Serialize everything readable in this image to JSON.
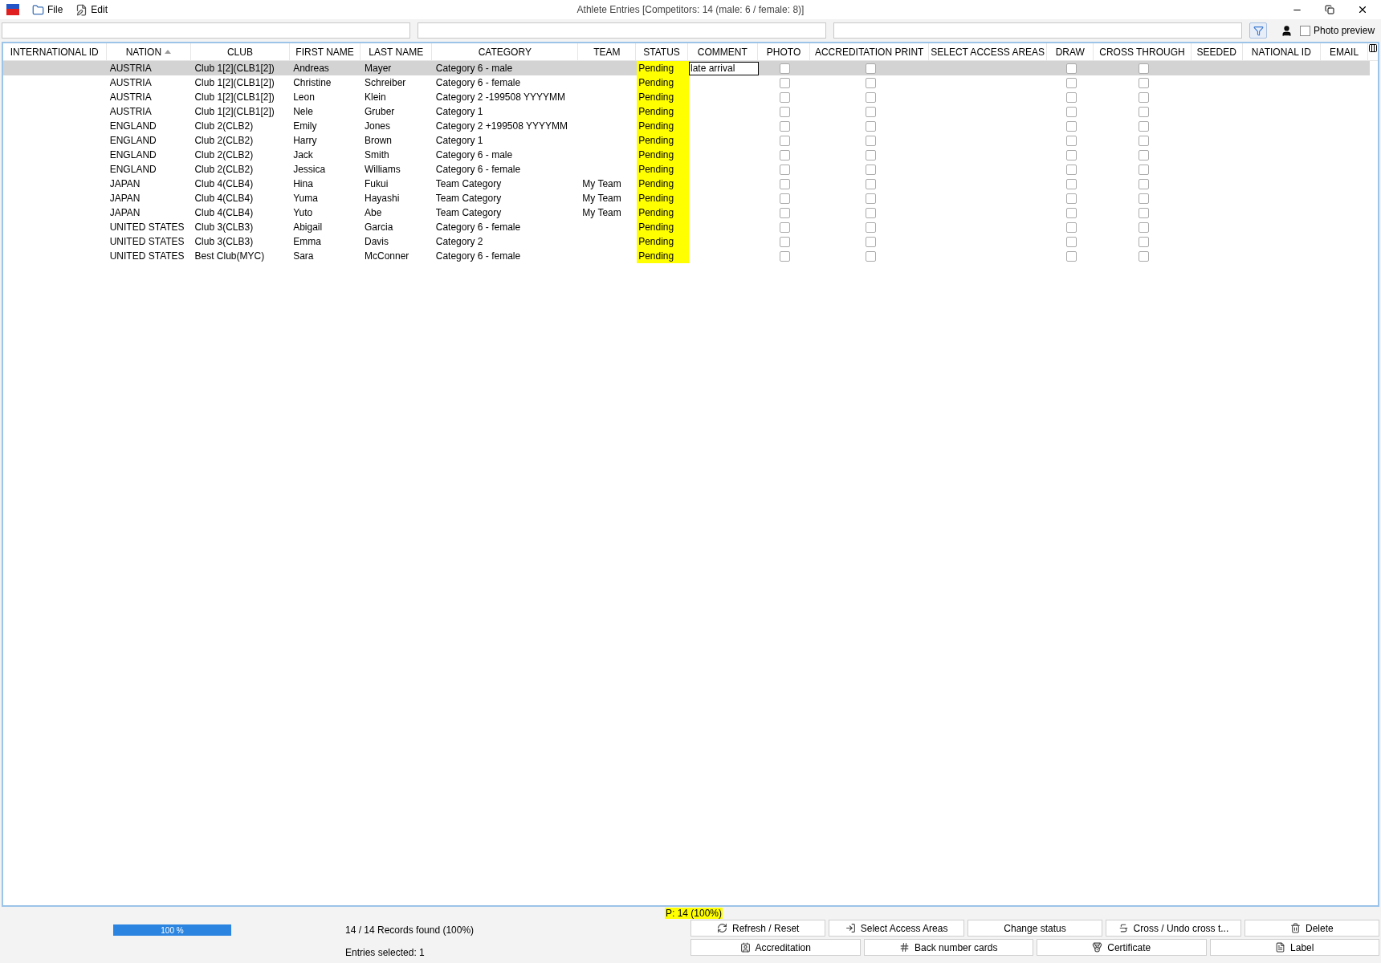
{
  "window": {
    "title": "Athlete Entries [Competitors: 14 (male: 6 / female: 8)]"
  },
  "menu": [
    "File",
    "Edit"
  ],
  "photo_preview": {
    "label": "Photo preview",
    "checked": false
  },
  "table": {
    "columns": [
      {
        "label": "INTERNATIONAL ID",
        "sorted": false
      },
      {
        "label": "NATION",
        "sorted": true
      },
      {
        "label": "CLUB",
        "sorted": false
      },
      {
        "label": "FIRST NAME",
        "sorted": false
      },
      {
        "label": "LAST NAME",
        "sorted": false
      },
      {
        "label": "CATEGORY",
        "sorted": false
      },
      {
        "label": "TEAM",
        "sorted": false
      },
      {
        "label": "STATUS",
        "sorted": false,
        "kind": "status"
      },
      {
        "label": "COMMENT",
        "sorted": false,
        "kind": "comment"
      },
      {
        "label": "PHOTO",
        "sorted": false,
        "kind": "checkbox"
      },
      {
        "label": "ACCREDITATION PRINT",
        "sorted": false,
        "kind": "checkbox"
      },
      {
        "label": "SELECT ACCESS AREAS",
        "sorted": false
      },
      {
        "label": "DRAW",
        "sorted": false,
        "kind": "checkbox"
      },
      {
        "label": "CROSS THROUGH",
        "sorted": false,
        "kind": "checkbox"
      },
      {
        "label": "SEEDED",
        "sorted": false
      },
      {
        "label": "NATIONAL ID",
        "sorted": false
      },
      {
        "label": "EMAIL",
        "sorted": false
      }
    ],
    "rows": [
      {
        "selected": true,
        "nation": "AUSTRIA",
        "club": "Club 1[2](CLB1[2])",
        "first_name": "Andreas",
        "last_name": "Mayer",
        "category": "Category 6 - male",
        "status": "Pending",
        "comment": "late arrival",
        "photo": false,
        "accreditation_print": false,
        "draw": false,
        "cross_through": false
      },
      {
        "selected": false,
        "nation": "AUSTRIA",
        "club": "Club 1[2](CLB1[2])",
        "first_name": "Christine",
        "last_name": "Schreiber",
        "category": "Category 6 - female",
        "status": "Pending",
        "photo": false,
        "accreditation_print": false,
        "draw": false,
        "cross_through": false
      },
      {
        "selected": false,
        "nation": "AUSTRIA",
        "club": "Club 1[2](CLB1[2])",
        "first_name": "Leon",
        "last_name": "Klein",
        "category": "Category 2 -199508 YYYYMM",
        "status": "Pending",
        "photo": false,
        "accreditation_print": false,
        "draw": false,
        "cross_through": false
      },
      {
        "selected": false,
        "nation": "AUSTRIA",
        "club": "Club 1[2](CLB1[2])",
        "first_name": "Nele",
        "last_name": "Gruber",
        "category": "Category 1",
        "status": "Pending",
        "photo": false,
        "accreditation_print": false,
        "draw": false,
        "cross_through": false
      },
      {
        "selected": false,
        "nation": "ENGLAND",
        "club": "Club 2(CLB2)",
        "first_name": "Emily",
        "last_name": "Jones",
        "category": "Category 2 +199508 YYYYMM",
        "status": "Pending",
        "photo": false,
        "accreditation_print": false,
        "draw": false,
        "cross_through": false
      },
      {
        "selected": false,
        "nation": "ENGLAND",
        "club": "Club 2(CLB2)",
        "first_name": "Harry",
        "last_name": "Brown",
        "category": "Category 1",
        "status": "Pending",
        "photo": false,
        "accreditation_print": false,
        "draw": false,
        "cross_through": false
      },
      {
        "selected": false,
        "nation": "ENGLAND",
        "club": "Club 2(CLB2)",
        "first_name": "Jack",
        "last_name": "Smith",
        "category": "Category 6 - male",
        "status": "Pending",
        "photo": false,
        "accreditation_print": false,
        "draw": false,
        "cross_through": false
      },
      {
        "selected": false,
        "nation": "ENGLAND",
        "club": "Club 2(CLB2)",
        "first_name": "Jessica",
        "last_name": "Williams",
        "category": "Category 6 - female",
        "status": "Pending",
        "photo": false,
        "accreditation_print": false,
        "draw": false,
        "cross_through": false
      },
      {
        "selected": false,
        "nation": "JAPAN",
        "club": "Club 4(CLB4)",
        "first_name": "Hina",
        "last_name": "Fukui",
        "category": "Team Category",
        "team": "My Team",
        "status": "Pending",
        "photo": false,
        "accreditation_print": false,
        "draw": false,
        "cross_through": false
      },
      {
        "selected": false,
        "nation": "JAPAN",
        "club": "Club 4(CLB4)",
        "first_name": "Yuma",
        "last_name": "Hayashi",
        "category": "Team Category",
        "team": "My Team",
        "status": "Pending",
        "photo": false,
        "accreditation_print": false,
        "draw": false,
        "cross_through": false
      },
      {
        "selected": false,
        "nation": "JAPAN",
        "club": "Club 4(CLB4)",
        "first_name": "Yuto",
        "last_name": "Abe",
        "category": "Team Category",
        "team": "My Team",
        "status": "Pending",
        "photo": false,
        "accreditation_print": false,
        "draw": false,
        "cross_through": false
      },
      {
        "selected": false,
        "nation": "UNITED STATES",
        "club": "Club 3(CLB3)",
        "first_name": "Abigail",
        "last_name": "Garcia",
        "category": "Category 6 - female",
        "status": "Pending",
        "photo": false,
        "accreditation_print": false,
        "draw": false,
        "cross_through": false
      },
      {
        "selected": false,
        "nation": "UNITED STATES",
        "club": "Club 3(CLB3)",
        "first_name": "Emma",
        "last_name": "Davis",
        "category": "Category 2",
        "status": "Pending",
        "photo": false,
        "accreditation_print": false,
        "draw": false,
        "cross_through": false
      },
      {
        "selected": false,
        "nation": "UNITED STATES",
        "club": "Best Club(MYC)",
        "first_name": "Sara",
        "last_name": "McConner",
        "category": "Category 6 - female",
        "status": "Pending",
        "photo": false,
        "accreditation_print": false,
        "draw": false,
        "cross_through": false
      }
    ]
  },
  "status_summary": "P: 14 (100%)",
  "progress": {
    "level": 1,
    "label": "100 %"
  },
  "records_found": "14 / 14 Records found (100%)",
  "entries_selected": "Entries selected: 1",
  "buttons": [
    "Refresh / Reset",
    "Select Access Areas",
    "Change status",
    "Cross / Undo cross t...",
    "Delete"
  ],
  "buttons_row_2": [
    "Accreditation",
    "Back number cards",
    "Certificate",
    "Label"
  ]
}
